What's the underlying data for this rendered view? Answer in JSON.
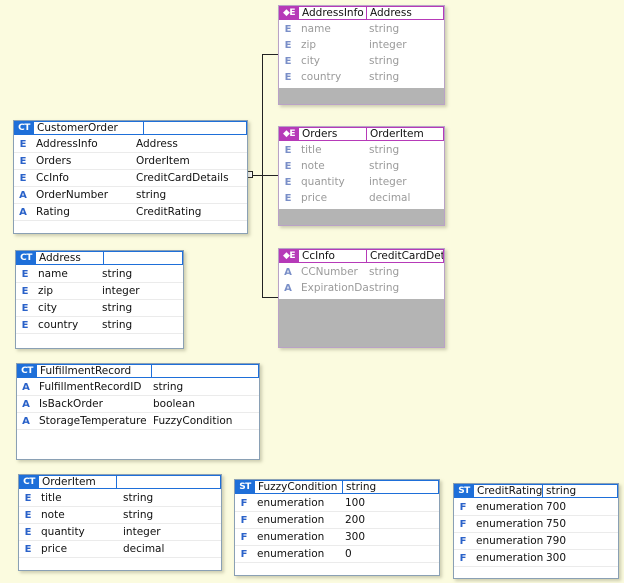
{
  "badges": {
    "complex_type": "CT",
    "simple_type": "ST",
    "element": "E"
  },
  "element_boxes": [
    {
      "name": "AddressInfo",
      "type": "Address",
      "rows": [
        {
          "icon": "E",
          "name": "name",
          "type": "string"
        },
        {
          "icon": "E",
          "name": "zip",
          "type": "integer"
        },
        {
          "icon": "E",
          "name": "city",
          "type": "string"
        },
        {
          "icon": "E",
          "name": "country",
          "type": "string"
        }
      ]
    },
    {
      "name": "Orders",
      "type": "OrderItem",
      "rows": [
        {
          "icon": "E",
          "name": "title",
          "type": "string"
        },
        {
          "icon": "E",
          "name": "note",
          "type": "string"
        },
        {
          "icon": "E",
          "name": "quantity",
          "type": "integer"
        },
        {
          "icon": "E",
          "name": "price",
          "type": "decimal"
        }
      ]
    },
    {
      "name": "CcInfo",
      "type": "CreditCardDet",
      "rows": [
        {
          "icon": "A",
          "name": "CCNumber",
          "type": "string"
        },
        {
          "icon": "A",
          "name": "ExpirationDa",
          "type": "string"
        }
      ]
    }
  ],
  "complex_types": [
    {
      "name": "CustomerOrder",
      "type": "",
      "rows": [
        {
          "icon": "E",
          "name": "AddressInfo",
          "type": "Address"
        },
        {
          "icon": "E",
          "name": "Orders",
          "type": "OrderItem"
        },
        {
          "icon": "E",
          "name": "CcInfo",
          "type": "CreditCardDetails"
        },
        {
          "icon": "A",
          "name": "OrderNumber",
          "type": "string"
        },
        {
          "icon": "A",
          "name": "Rating",
          "type": "CreditRating"
        }
      ]
    },
    {
      "name": "Address",
      "type": "",
      "rows": [
        {
          "icon": "E",
          "name": "name",
          "type": "string"
        },
        {
          "icon": "E",
          "name": "zip",
          "type": "integer"
        },
        {
          "icon": "E",
          "name": "city",
          "type": "string"
        },
        {
          "icon": "E",
          "name": "country",
          "type": "string"
        }
      ]
    },
    {
      "name": "FulfillmentRecord",
      "type": "",
      "rows": [
        {
          "icon": "A",
          "name": "FulfillmentRecordID",
          "type": "string"
        },
        {
          "icon": "A",
          "name": "IsBackOrder",
          "type": "boolean"
        },
        {
          "icon": "A",
          "name": "StorageTemperature",
          "type": "FuzzyCondition"
        }
      ]
    },
    {
      "name": "OrderItem",
      "type": "",
      "rows": [
        {
          "icon": "E",
          "name": "title",
          "type": "string"
        },
        {
          "icon": "E",
          "name": "note",
          "type": "string"
        },
        {
          "icon": "E",
          "name": "quantity",
          "type": "integer"
        },
        {
          "icon": "E",
          "name": "price",
          "type": "decimal"
        }
      ]
    }
  ],
  "simple_types": [
    {
      "name": "FuzzyCondition",
      "type": "string",
      "rows": [
        {
          "icon": "F",
          "name": "enumeration",
          "type": "100"
        },
        {
          "icon": "F",
          "name": "enumeration",
          "type": "200"
        },
        {
          "icon": "F",
          "name": "enumeration",
          "type": "300"
        },
        {
          "icon": "F",
          "name": "enumeration",
          "type": "0"
        }
      ]
    },
    {
      "name": "CreditRating",
      "type": "string",
      "rows": [
        {
          "icon": "F",
          "name": "enumeration",
          "type": "700"
        },
        {
          "icon": "F",
          "name": "enumeration",
          "type": "750"
        },
        {
          "icon": "F",
          "name": "enumeration",
          "type": "790"
        },
        {
          "icon": "F",
          "name": "enumeration",
          "type": "300"
        }
      ]
    }
  ],
  "colors": {
    "canvas": "#fbfbdf",
    "complex_type_accent": "#1e6fd9",
    "element_accent": "#b63ab8",
    "expanded_fill": "#b4b4b4"
  }
}
